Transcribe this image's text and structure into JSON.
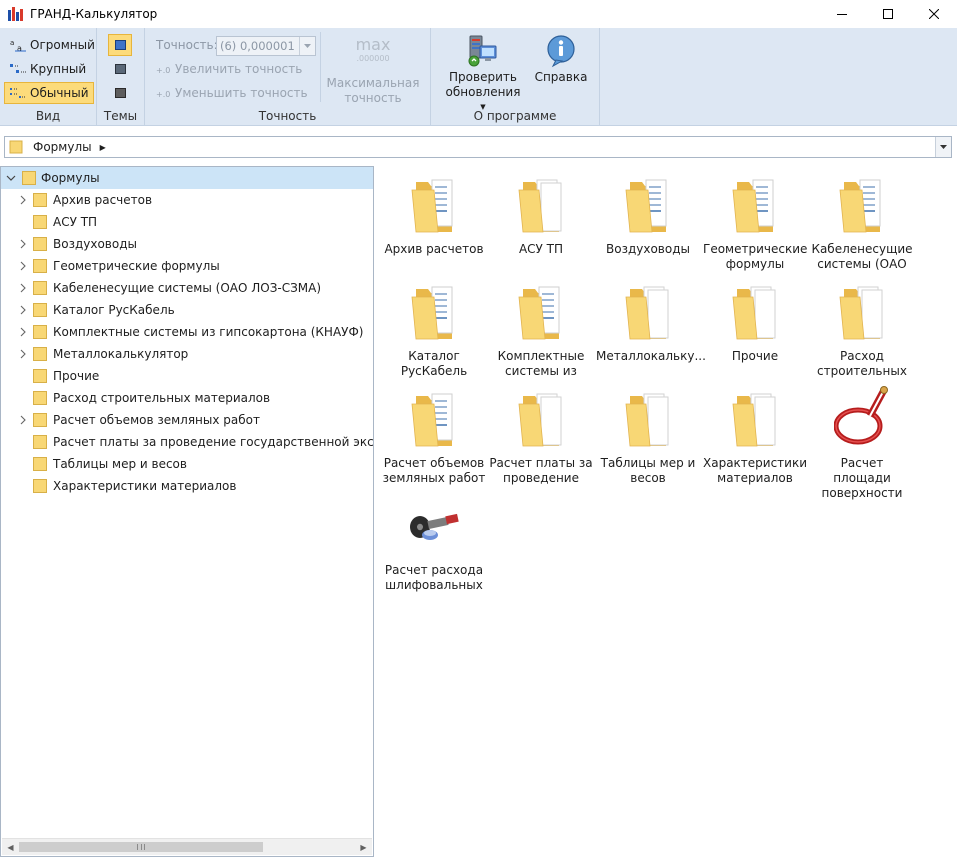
{
  "window": {
    "title": "ГРАНД-Калькулятор"
  },
  "ribbon": {
    "view_group": {
      "label": "Вид",
      "huge": "Огромный",
      "large": "Крупный",
      "normal": "Обычный"
    },
    "themes_group": {
      "label": "Темы"
    },
    "precision_group": {
      "label": "Точность",
      "precision_label": "Точность:",
      "precision_value": "(6)  0,000001",
      "increase": "Увеличить точность",
      "decrease": "Уменьшить точность",
      "max_icon_top": "max",
      "max_icon_bottom": ".000000",
      "max_label_line1": "Максимальная",
      "max_label_line2": "точность"
    },
    "about_group": {
      "label": "О программе",
      "check_updates_line1": "Проверить",
      "check_updates_line2": "обновления",
      "help": "Справка"
    }
  },
  "address_bar": {
    "path": "Формулы"
  },
  "tree": {
    "root": "Формулы",
    "items": [
      {
        "label": "Архив расчетов",
        "expandable": true
      },
      {
        "label": "АСУ ТП",
        "expandable": false
      },
      {
        "label": "Воздуховоды",
        "expandable": true
      },
      {
        "label": "Геометрические формулы",
        "expandable": true
      },
      {
        "label": "Кабеленесущие системы (ОАО ЛОЗ-СЗМА)",
        "expandable": true
      },
      {
        "label": "Каталог РусКабель",
        "expandable": true
      },
      {
        "label": "Комплектные системы из гипсокартона (КНАУФ)",
        "expandable": true
      },
      {
        "label": "Металлокалькулятор",
        "expandable": true
      },
      {
        "label": "Прочие",
        "expandable": false
      },
      {
        "label": "Расход строительных материалов",
        "expandable": false
      },
      {
        "label": "Расчет объемов земляных работ",
        "expandable": true
      },
      {
        "label": "Расчет платы за проведение государственной экспертизы",
        "expandable": false
      },
      {
        "label": "Таблицы мер и весов",
        "expandable": false
      },
      {
        "label": "Характеристики материалов",
        "expandable": false
      }
    ]
  },
  "grid": {
    "items": [
      {
        "line1": "Архив расчетов",
        "line2": "",
        "icon": "folder-full-icon"
      },
      {
        "line1": "АСУ ТП",
        "line2": "",
        "icon": "folder-docs-icon"
      },
      {
        "line1": "Воздуховоды",
        "line2": "",
        "icon": "folder-full-icon"
      },
      {
        "line1": "Геометрические",
        "line2": "формулы",
        "icon": "folder-full-icon"
      },
      {
        "line1": "Кабеленесущие",
        "line2": "системы (ОАО",
        "icon": "folder-full-icon"
      },
      {
        "line1": "Каталог",
        "line2": "РусКабель",
        "icon": "folder-full-icon"
      },
      {
        "line1": "Комплектные",
        "line2": "системы из",
        "icon": "folder-full-icon"
      },
      {
        "line1": "Металлокальку...",
        "line2": "",
        "icon": "folder-docs-icon"
      },
      {
        "line1": "Прочие",
        "line2": "",
        "icon": "folder-docs-icon"
      },
      {
        "line1": "Расход",
        "line2": "строительных",
        "icon": "folder-docs-icon"
      },
      {
        "line1": "Расчет объемов",
        "line2": "земляных работ",
        "icon": "folder-full-icon"
      },
      {
        "line1": "Расчет платы за",
        "line2": "проведение",
        "icon": "folder-docs-icon"
      },
      {
        "line1": "Таблицы мер и",
        "line2": "весов",
        "icon": "folder-docs-icon"
      },
      {
        "line1": "Характеристики",
        "line2": "материалов",
        "icon": "folder-docs-icon"
      },
      {
        "line1": "Расчет площади",
        "line2": "поверхности",
        "icon": "cable-icon"
      },
      {
        "line1": "Расчет расхода",
        "line2": "шлифовальных",
        "icon": "grinding-disc-icon"
      }
    ]
  },
  "colors": {
    "ribbon_bg": "#dde7f3",
    "active_highlight": "#fcdb7b",
    "tree_selection": "#cce4f7",
    "folder_yellow": "#f8d775"
  }
}
